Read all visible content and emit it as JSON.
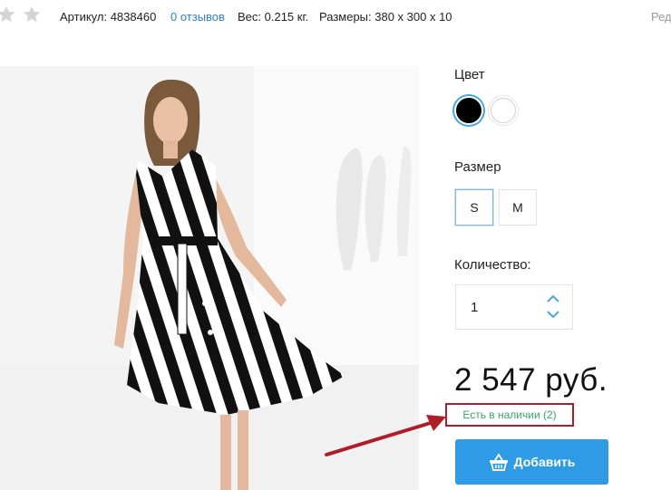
{
  "header": {
    "article": "Артикул: 4838460",
    "reviews": "0 отзывов",
    "weight": "Вес: 0.215 кг.",
    "dimensions": "Размеры: 380 x 300 x 10",
    "edit": "Ред"
  },
  "product": {
    "color_label": "Цвет",
    "colors": [
      "black",
      "white"
    ],
    "size_label": "Размер",
    "sizes": [
      "S",
      "M"
    ],
    "selected_size": "S",
    "quantity_label": "Количество:",
    "quantity": "1",
    "price": "2 547 руб.",
    "stock": "Есть в наличии (2)",
    "add_button": "Добавить"
  },
  "colors": {
    "accent": "#2f9ae6",
    "stock_text": "#3aa56a",
    "highlight_box": "#b01d2a",
    "link": "#2c7fd1"
  },
  "icons": [
    "star-icon",
    "star-icon",
    "chevron-up-icon",
    "chevron-down-icon",
    "basket-icon",
    "annotation-arrow"
  ]
}
